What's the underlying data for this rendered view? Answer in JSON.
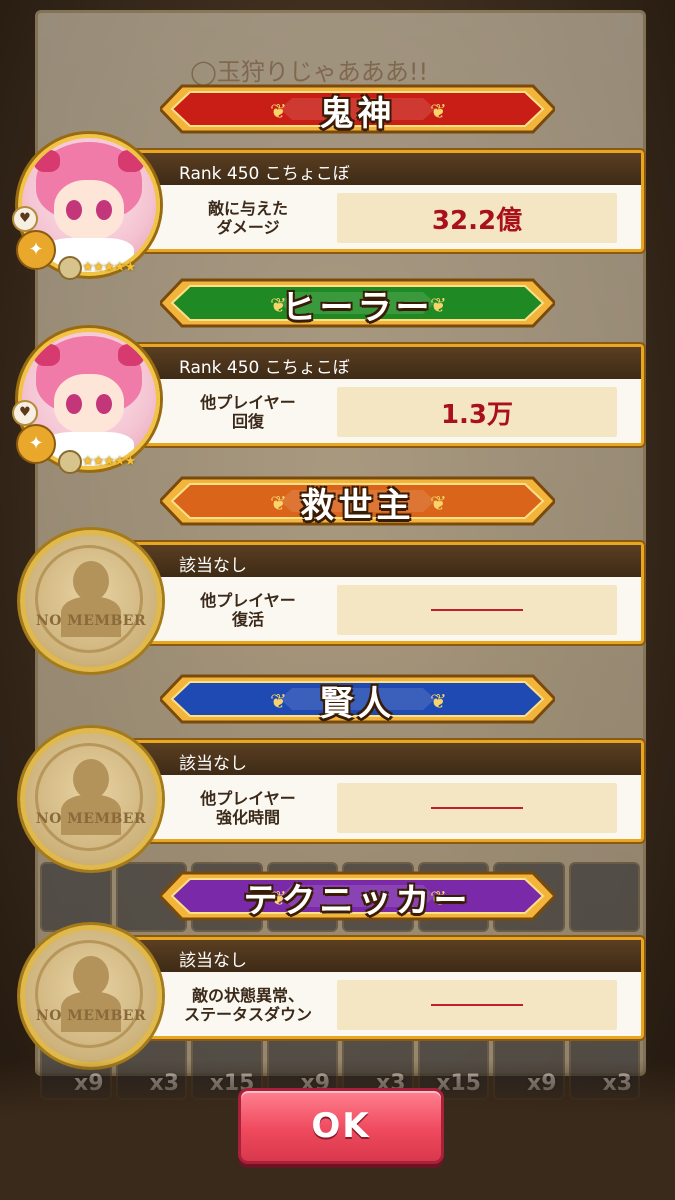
{
  "background": {
    "scroll_title": "◯玉狩りじゃあああ!!",
    "items_row": [
      "x9",
      "x3",
      "x15",
      "x9",
      "x3",
      "x15",
      "x9",
      "x3"
    ]
  },
  "awards": [
    {
      "title": "鬼神",
      "banner_color": "#c81e16",
      "player_name": "Rank  450  こちょこぼ",
      "description": "敵に与えた\nダメージ",
      "value": "32.2億",
      "has_member": true
    },
    {
      "title": "ヒーラー",
      "banner_color": "#1f8a23",
      "player_name": "Rank  450  こちょこぼ",
      "description": "他プレイヤー\n回復",
      "value": "1.3万",
      "has_member": true
    },
    {
      "title": "救世主",
      "banner_color": "#d9641a",
      "player_name": "該当なし",
      "description": "他プレイヤー\n復活",
      "value": "",
      "has_member": false
    },
    {
      "title": "賢人",
      "banner_color": "#1f4ab3",
      "player_name": "該当なし",
      "description": "他プレイヤー\n強化時間",
      "value": "",
      "has_member": false
    },
    {
      "title": "テクニッカー",
      "banner_color": "#7a2aa8",
      "player_name": "該当なし",
      "description": "敵の状態異常、\nステータスダウン",
      "value": "",
      "has_member": false
    }
  ],
  "no_member_label": "NO MEMBER",
  "ok_label": "OK"
}
